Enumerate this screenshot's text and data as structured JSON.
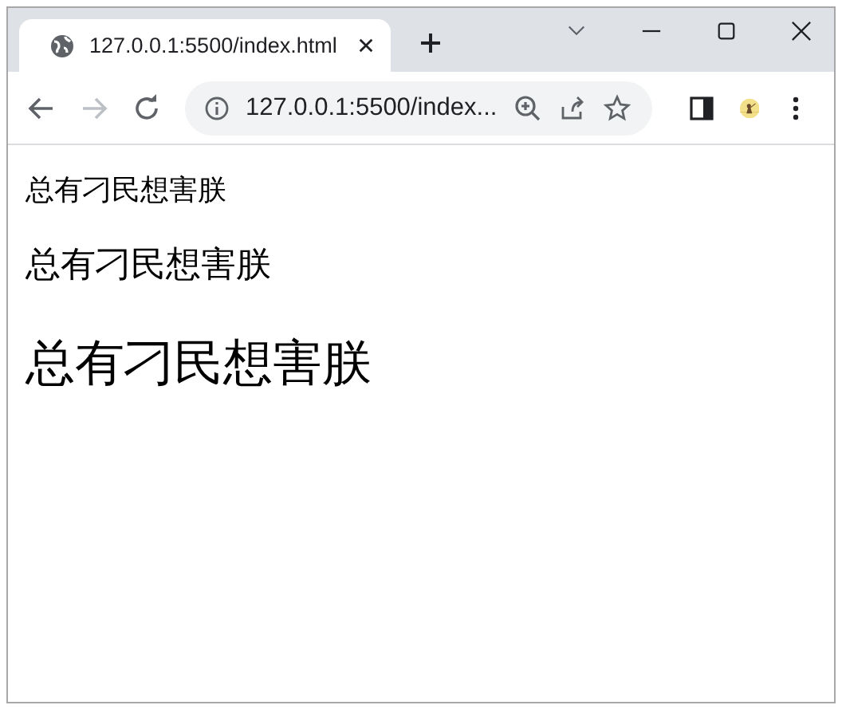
{
  "tabs": [
    {
      "title": "127.0.0.1:5500/index.html",
      "selected": true
    }
  ],
  "address_bar": {
    "url": "127.0.0.1:5500/index..."
  },
  "navigation": {
    "forward_disabled": true
  },
  "content": [
    {
      "kind": "small",
      "text": "总有刁民想害朕"
    },
    {
      "kind": "medium",
      "text": "总有刁民想害朕"
    },
    {
      "kind": "large",
      "text": "总有刁民想害朕"
    }
  ]
}
